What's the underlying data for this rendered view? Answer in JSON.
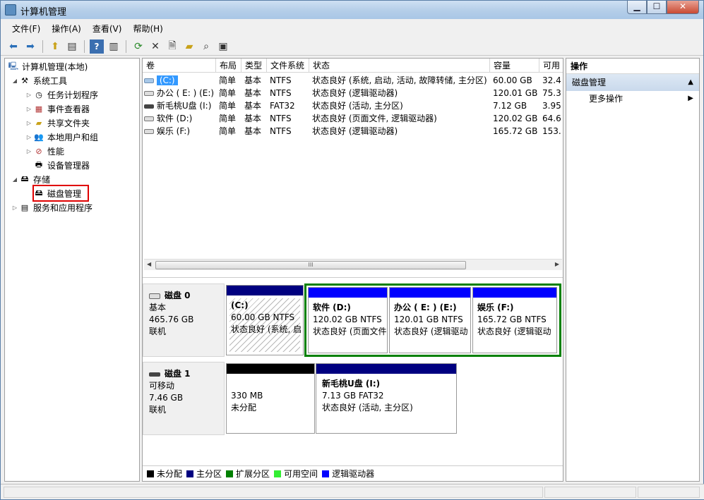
{
  "window": {
    "title": "计算机管理"
  },
  "menu": [
    "文件(F)",
    "操作(A)",
    "查看(V)",
    "帮助(H)"
  ],
  "toolbar": {
    "icons": [
      "back-icon",
      "forward-icon",
      "up-icon",
      "show-hide-tree-icon",
      "help-icon",
      "panel-icon",
      "refresh-icon",
      "delete-icon",
      "properties-icon",
      "open-icon",
      "search-icon",
      "settings-icon"
    ]
  },
  "tree": {
    "root": "计算机管理(本地)",
    "system_tools": "系统工具",
    "task_scheduler": "任务计划程序",
    "event_viewer": "事件查看器",
    "shared_folders": "共享文件夹",
    "local_users": "本地用户和组",
    "performance": "性能",
    "device_manager": "设备管理器",
    "storage": "存储",
    "disk_management": "磁盘管理",
    "services_apps": "服务和应用程序"
  },
  "volume_table": {
    "headers": [
      "卷",
      "布局",
      "类型",
      "文件系统",
      "状态",
      "容量",
      "可用"
    ],
    "rows": [
      [
        "(C:)",
        "简单",
        "基本",
        "NTFS",
        "状态良好 (系统, 启动, 活动, 故障转储, 主分区)",
        "60.00 GB",
        "32.4"
      ],
      [
        "办公 ( E: ) (E:)",
        "简单",
        "基本",
        "NTFS",
        "状态良好 (逻辑驱动器)",
        "120.01 GB",
        "75.3"
      ],
      [
        "新毛桃U盘 (I:)",
        "简单",
        "基本",
        "FAT32",
        "状态良好 (活动, 主分区)",
        "7.12 GB",
        "3.95"
      ],
      [
        "软件 (D:)",
        "简单",
        "基本",
        "NTFS",
        "状态良好 (页面文件, 逻辑驱动器)",
        "120.02 GB",
        "64.6"
      ],
      [
        "娱乐 (F:)",
        "简单",
        "基本",
        "NTFS",
        "状态良好 (逻辑驱动器)",
        "165.72 GB",
        "153."
      ]
    ],
    "scroll_label": "III"
  },
  "disk0": {
    "name": "磁盘 0",
    "type": "基本",
    "size": "465.76 GB",
    "status": "联机",
    "partitions": [
      {
        "name": "(C:)",
        "size": "60.00 GB NTFS",
        "status": "状态良好 (系统, 启"
      },
      {
        "name": "软件 (D:)",
        "size": "120.02 GB NTFS",
        "status": "状态良好 (页面文件"
      },
      {
        "name": "办公 ( E: ) (E:)",
        "size": "120.01 GB NTFS",
        "status": "状态良好 (逻辑驱动"
      },
      {
        "name": "娱乐 (F:)",
        "size": "165.72 GB NTFS",
        "status": "状态良好 (逻辑驱动"
      }
    ]
  },
  "disk1": {
    "name": "磁盘 1",
    "type": "可移动",
    "size": "7.46 GB",
    "status": "联机",
    "partitions": [
      {
        "name": "",
        "size": "330 MB",
        "status": "未分配"
      },
      {
        "name": "新毛桃U盘 (I:)",
        "size": "7.13 GB FAT32",
        "status": "状态良好 (活动, 主分区)"
      }
    ]
  },
  "legend": [
    {
      "label": "未分配",
      "color": "#000000"
    },
    {
      "label": "主分区",
      "color": "#000080"
    },
    {
      "label": "扩展分区",
      "color": "#008000"
    },
    {
      "label": "可用空间",
      "color": "#33ee33"
    },
    {
      "label": "逻辑驱动器",
      "color": "#0000ff"
    }
  ],
  "actions": {
    "header": "操作",
    "section": "磁盘管理",
    "more": "更多操作"
  }
}
